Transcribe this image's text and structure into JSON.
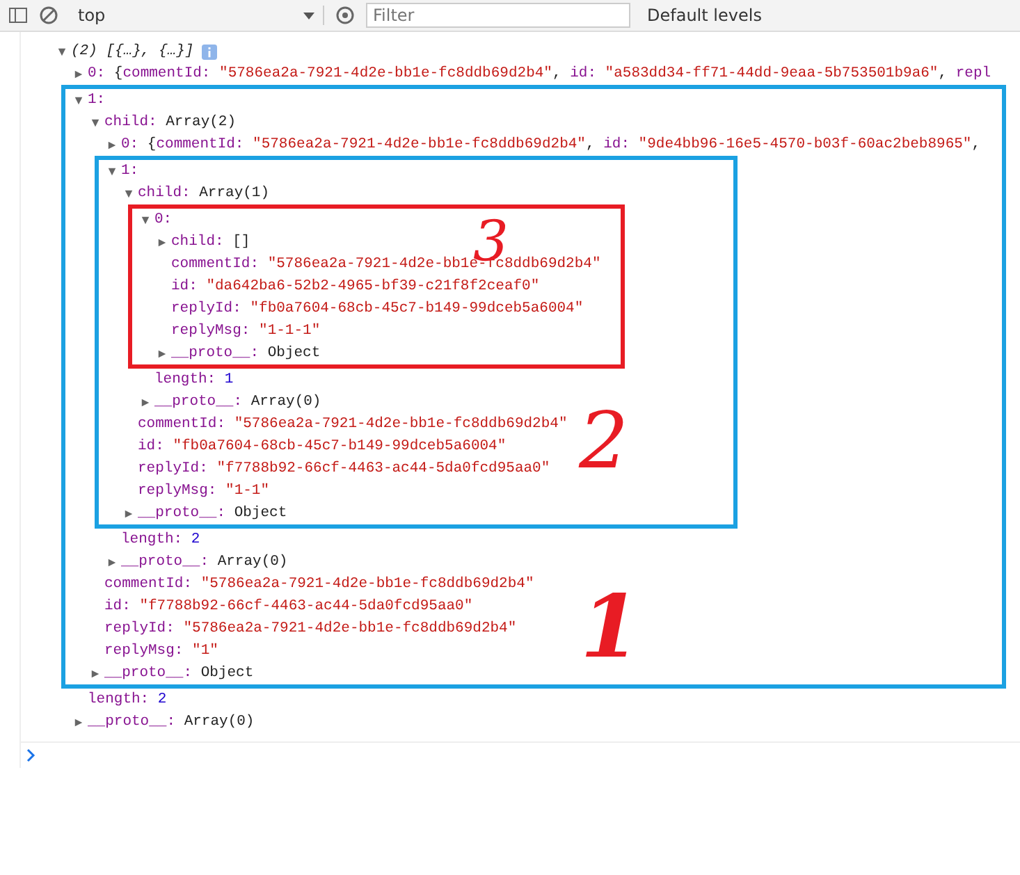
{
  "toolbar": {
    "context": "top",
    "filter": {
      "placeholder": "Filter"
    },
    "levels": "Default levels"
  },
  "console": {
    "root": {
      "summary": "(2) [{…}, {…}]",
      "expanded": true,
      "children": [
        {
          "key": "0:",
          "expanded": false,
          "preview": [
            {
              "kind": "punct",
              "t": "{"
            },
            {
              "kind": "key",
              "t": "commentId:"
            },
            {
              "kind": "string",
              "t": "\"5786ea2a-7921-4d2e-bb1e-fc8ddb69d2b4\""
            },
            {
              "kind": "punct",
              "t": ","
            },
            {
              "kind": "key",
              "t": "id:"
            },
            {
              "kind": "string",
              "t": "\"a583dd34-ff71-44dd-9eaa-5b753501b9a6\""
            },
            {
              "kind": "punct",
              "t": ","
            },
            {
              "kind": "key",
              "t": "repl"
            }
          ]
        },
        {
          "key": "1:",
          "expanded": true,
          "color": "#1ba1e2",
          "annotation": "1",
          "children": [
            {
              "key": "child:",
              "value": "Array(2)",
              "kind": "plain",
              "expanded": true,
              "children": [
                {
                  "key": "0:",
                  "expanded": false,
                  "preview": [
                    {
                      "kind": "punct",
                      "t": "{"
                    },
                    {
                      "kind": "key",
                      "t": "commentId:"
                    },
                    {
                      "kind": "string",
                      "t": "\"5786ea2a-7921-4d2e-bb1e-fc8ddb69d2b4\""
                    },
                    {
                      "kind": "punct",
                      "t": ","
                    },
                    {
                      "kind": "key",
                      "t": "id:"
                    },
                    {
                      "kind": "string",
                      "t": "\"9de4bb96-16e5-4570-b03f-60ac2beb8965\""
                    },
                    {
                      "kind": "punct",
                      "t": ","
                    }
                  ]
                },
                {
                  "key": "1:",
                  "expanded": true,
                  "color": "#1ba1e2",
                  "annotation": "2",
                  "children": [
                    {
                      "key": "child:",
                      "value": "Array(1)",
                      "kind": "plain",
                      "expanded": true,
                      "children": [
                        {
                          "key": "0:",
                          "expanded": true,
                          "color": "#e81c24",
                          "annotation": "3",
                          "children": [
                            {
                              "key": "child:",
                              "value": "[]",
                              "kind": "plain",
                              "expanded": false
                            },
                            {
                              "key": "commentId:",
                              "value": "\"5786ea2a-7921-4d2e-bb1e-fc8ddb69d2b4\"",
                              "kind": "string"
                            },
                            {
                              "key": "id:",
                              "value": "\"da642ba6-52b2-4965-bf39-c21f8f2ceaf0\"",
                              "kind": "string"
                            },
                            {
                              "key": "replyId:",
                              "value": "\"fb0a7604-68cb-45c7-b149-99dceb5a6004\"",
                              "kind": "string"
                            },
                            {
                              "key": "replyMsg:",
                              "value": "\"1-1-1\"",
                              "kind": "string"
                            },
                            {
                              "key": "__proto__:",
                              "value": "Object",
                              "kind": "plain",
                              "expanded": false
                            }
                          ]
                        },
                        {
                          "key": "length:",
                          "value": "1",
                          "kind": "number"
                        },
                        {
                          "key": "__proto__:",
                          "value": "Array(0)",
                          "kind": "plain",
                          "expanded": false
                        }
                      ]
                    },
                    {
                      "key": "commentId:",
                      "value": "\"5786ea2a-7921-4d2e-bb1e-fc8ddb69d2b4\"",
                      "kind": "string"
                    },
                    {
                      "key": "id:",
                      "value": "\"fb0a7604-68cb-45c7-b149-99dceb5a6004\"",
                      "kind": "string"
                    },
                    {
                      "key": "replyId:",
                      "value": "\"f7788b92-66cf-4463-ac44-5da0fcd95aa0\"",
                      "kind": "string"
                    },
                    {
                      "key": "replyMsg:",
                      "value": "\"1-1\"",
                      "kind": "string"
                    },
                    {
                      "key": "__proto__:",
                      "value": "Object",
                      "kind": "plain",
                      "expanded": false
                    }
                  ]
                },
                {
                  "key": "length:",
                  "value": "2",
                  "kind": "number"
                },
                {
                  "key": "__proto__:",
                  "value": "Array(0)",
                  "kind": "plain",
                  "expanded": false
                }
              ]
            },
            {
              "key": "commentId:",
              "value": "\"5786ea2a-7921-4d2e-bb1e-fc8ddb69d2b4\"",
              "kind": "string"
            },
            {
              "key": "id:",
              "value": "\"f7788b92-66cf-4463-ac44-5da0fcd95aa0\"",
              "kind": "string"
            },
            {
              "key": "replyId:",
              "value": "\"5786ea2a-7921-4d2e-bb1e-fc8ddb69d2b4\"",
              "kind": "string"
            },
            {
              "key": "replyMsg:",
              "value": "\"1\"",
              "kind": "string"
            },
            {
              "key": "__proto__:",
              "value": "Object",
              "kind": "plain",
              "expanded": false
            }
          ]
        },
        {
          "key": "length:",
          "value": "2",
          "kind": "number"
        },
        {
          "key": "__proto__:",
          "value": "Array(0)",
          "kind": "plain",
          "expanded": false
        }
      ]
    }
  }
}
